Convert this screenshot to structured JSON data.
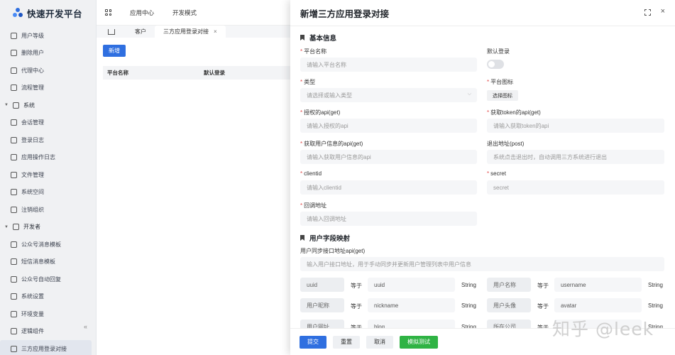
{
  "app": {
    "title": "快速开发平台"
  },
  "topnav": {
    "app_center": "应用中心",
    "dev_mode": "开发模式"
  },
  "sidebar": {
    "items": [
      {
        "label": "用户等级",
        "type": "item"
      },
      {
        "label": "删除用户",
        "type": "item"
      },
      {
        "label": "代理中心",
        "type": "item"
      },
      {
        "label": "流程管理",
        "type": "item"
      },
      {
        "label": "系统",
        "type": "group"
      },
      {
        "label": "会话管理",
        "type": "item"
      },
      {
        "label": "登录日志",
        "type": "item"
      },
      {
        "label": "应用操作日志",
        "type": "item"
      },
      {
        "label": "文件管理",
        "type": "item"
      },
      {
        "label": "系统空间",
        "type": "item"
      },
      {
        "label": "注销组织",
        "type": "item"
      },
      {
        "label": "开发者",
        "type": "group"
      },
      {
        "label": "公众号消息模板",
        "type": "item"
      },
      {
        "label": "短信消息模板",
        "type": "item"
      },
      {
        "label": "公众号自动回复",
        "type": "item"
      },
      {
        "label": "系统设置",
        "type": "item"
      },
      {
        "label": "环境变量",
        "type": "item"
      },
      {
        "label": "逻辑组件",
        "type": "item"
      },
      {
        "label": "三方应用登录对接",
        "type": "item",
        "active": true
      }
    ],
    "collapse_glyph": "«"
  },
  "tabs": [
    {
      "label": "客户"
    },
    {
      "label": "三方应用登录对接",
      "active": true,
      "close": "×"
    }
  ],
  "list": {
    "new_button": "新增",
    "columns": [
      "平台名称",
      "默认登录"
    ]
  },
  "drawer": {
    "title": "新增三方应用登录对接",
    "close_glyph": "×",
    "section_basic": "基本信息",
    "section_mapping": "用户字段映射",
    "fields": {
      "platform_name": {
        "label": "平台名称",
        "placeholder": "请输入平台名称"
      },
      "default_login": {
        "label": "默认登录",
        "value": false
      },
      "type": {
        "label": "类型",
        "placeholder": "请选择或输入类型"
      },
      "platform_icon": {
        "label": "平台图标",
        "button": "选择图标"
      },
      "auth_api": {
        "label": "授权的api(get)",
        "placeholder": "请输入授权的api"
      },
      "token_api": {
        "label": "获取token的api(get)",
        "placeholder": "请输入获取token的api"
      },
      "userinfo_api": {
        "label": "获取用户信息的api(get)",
        "placeholder": "请输入获取用户信息的api"
      },
      "logout_url": {
        "label": "退出地址(post)",
        "placeholder": "系统点击退出时，自动调用三方系统进行退出"
      },
      "clientid": {
        "label": "clientid",
        "placeholder": "请输入clientid"
      },
      "secret": {
        "label": "secret",
        "value": "secret"
      },
      "callback": {
        "label": "回调地址",
        "placeholder": "请输入回调地址"
      },
      "sync_api": {
        "label": "用户同步接口地址api(get)",
        "placeholder": "输入用户接口地址，用于手动同步并更新用户管理列表中用户信息"
      }
    },
    "equals": "等于",
    "mapping": [
      {
        "left": {
          "field": "uuid",
          "value": "uuid",
          "type": "String"
        },
        "right": {
          "field": "用户名称",
          "value": "username",
          "type": "String"
        }
      },
      {
        "left": {
          "field": "用户昵称",
          "value": "nickname",
          "type": "String"
        },
        "right": {
          "field": "用户头像",
          "value": "avatar",
          "type": "String"
        }
      },
      {
        "left": {
          "field": "用户网址",
          "value": "blog",
          "type": "String"
        },
        "right": {
          "field": "所在公司",
          "value": "",
          "type": "String"
        }
      }
    ],
    "footer": {
      "submit": "提交",
      "reset": "重置",
      "cancel": "取消",
      "test": "模拟测试"
    }
  },
  "watermark": "知乎 @leek"
}
